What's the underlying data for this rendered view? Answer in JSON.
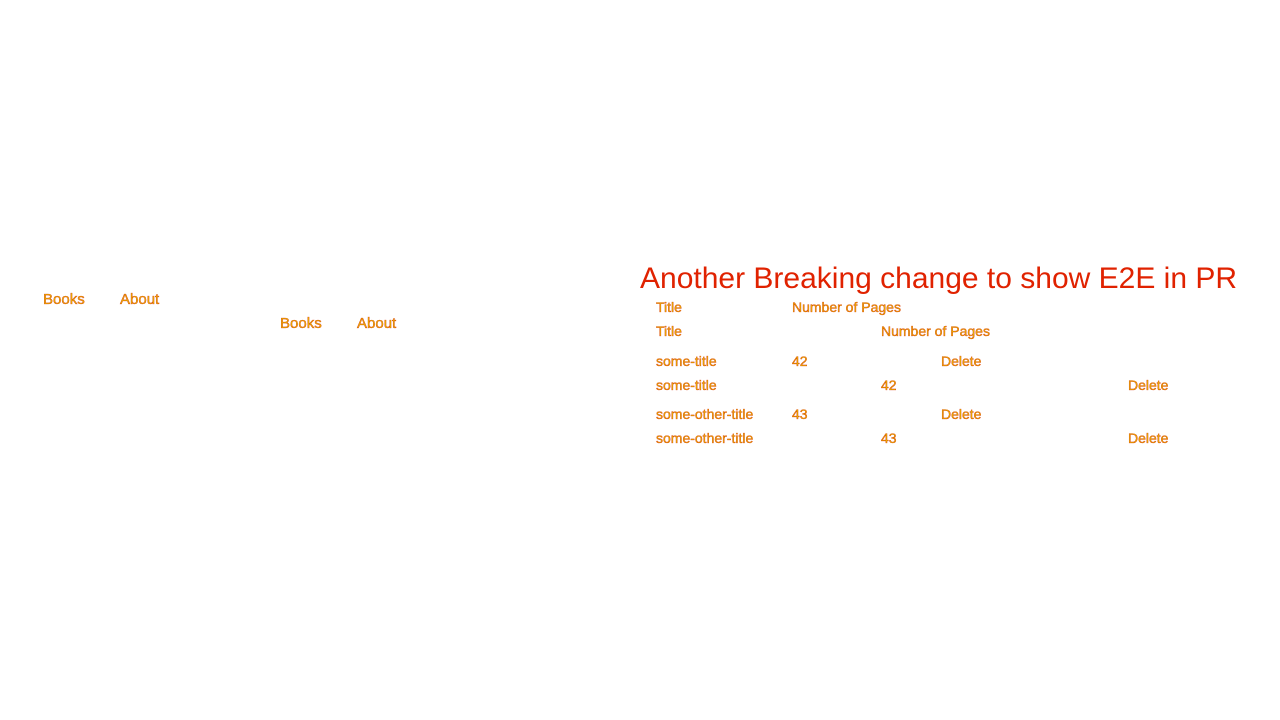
{
  "nav_primary": {
    "books_label": "Books",
    "about_label": "About"
  },
  "nav_secondary": {
    "books_label": "Books",
    "about_label": "About"
  },
  "main": {
    "title": "Another Breaking change to show E2E in PR"
  },
  "table_a": {
    "headers": [
      "Title",
      "Number of Pages"
    ],
    "rows": [
      {
        "title": "some-title",
        "pages": "42",
        "action": "Delete"
      },
      {
        "title": "some-other-title",
        "pages": "43",
        "action": "Delete"
      }
    ]
  },
  "table_b": {
    "headers": [
      "Title",
      "Number of Pages"
    ],
    "rows": [
      {
        "title": "some-title",
        "pages": "42",
        "action": "Delete"
      },
      {
        "title": "some-other-title",
        "pages": "43",
        "action": "Delete"
      }
    ]
  },
  "colors": {
    "text_fill": "#e8b400",
    "text_edge": "#d62a00",
    "title": "#e02200",
    "background": "#ffffff"
  }
}
